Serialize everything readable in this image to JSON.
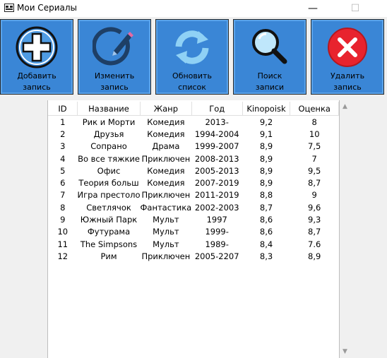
{
  "window": {
    "title": "Мои Сериалы",
    "minimize": "—",
    "maximize": "☐",
    "close": "✕"
  },
  "toolbar": {
    "buttons": [
      {
        "line1": "Добавить",
        "line2": "запись",
        "icon": "add-icon"
      },
      {
        "line1": "Изменить",
        "line2": "запись",
        "icon": "edit-icon"
      },
      {
        "line1": "Обновить",
        "line2": "список",
        "icon": "refresh-icon"
      },
      {
        "line1": "Поиск",
        "line2": "записи",
        "icon": "search-icon"
      },
      {
        "line1": "Удалить",
        "line2": "запись",
        "icon": "delete-icon"
      }
    ],
    "colors": {
      "button_bg": "#3a86d6",
      "delete_red": "#e8232e"
    }
  },
  "table": {
    "columns": [
      "ID",
      "Название",
      "Жанр",
      "Год",
      "Kinopoisk",
      "Оценка"
    ],
    "rows": [
      [
        "1",
        "Рик и Морти",
        "Комедия",
        "2013-",
        "9,2",
        "8"
      ],
      [
        "2",
        "Друзья",
        "Комедия",
        "1994-2004",
        "9,1",
        "10"
      ],
      [
        "3",
        "Сопрано",
        "Драма",
        "1999-2007",
        "8,9",
        "7,5"
      ],
      [
        "4",
        "Во все тяжкие",
        "Приключен",
        "2008-2013",
        "8,9",
        "7"
      ],
      [
        "5",
        "Офис",
        "Комедия",
        "2005-2013",
        "8,9",
        "9,5"
      ],
      [
        "6",
        "Теория больш",
        "Комедия",
        "2007-2019",
        "8,9",
        "8,7"
      ],
      [
        "7",
        "Игра престоло",
        "Приключен",
        "2011-2019",
        "8,8",
        "9"
      ],
      [
        "8",
        "Светлячок",
        "Фантастика",
        "2002-2003",
        "8,7",
        "9,6"
      ],
      [
        "9",
        "Южный Парк",
        "Мульт",
        "1997",
        "8,6",
        "9,3"
      ],
      [
        "10",
        "Футурама",
        "Мульт",
        "1999-",
        "8,6",
        "8,7"
      ],
      [
        "11",
        "The Simpsons",
        "Мульт",
        "1989-",
        "8,4",
        "7.6"
      ],
      [
        "12",
        "Рим",
        "Приключен",
        "2005-2207",
        "8,3",
        "8,9"
      ]
    ]
  },
  "scrollbar": {
    "up": "▲",
    "down": "▼"
  }
}
